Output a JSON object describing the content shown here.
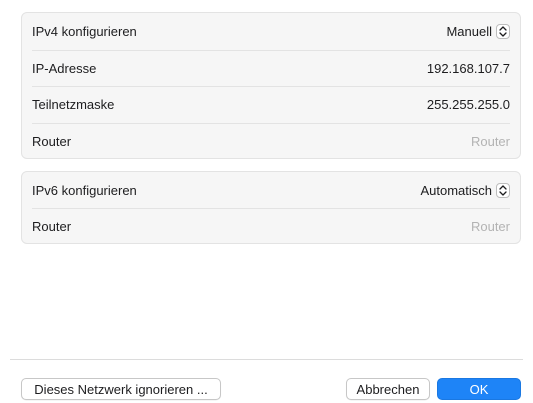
{
  "ipv4": {
    "configure_label": "IPv4 konfigurieren",
    "configure_value": "Manuell",
    "ip_label": "IP-Adresse",
    "ip_value": "192.168.107.7",
    "subnet_label": "Teilnetzmaske",
    "subnet_value": "255.255.255.0",
    "router_label": "Router",
    "router_placeholder": "Router"
  },
  "ipv6": {
    "configure_label": "IPv6 konfigurieren",
    "configure_value": "Automatisch",
    "router_label": "Router",
    "router_value": "Router"
  },
  "buttons": {
    "ignore": "Dieses Netzwerk ignorieren ...",
    "cancel": "Abbrechen",
    "ok": "OK"
  },
  "colors": {
    "accent": "#1e84f7",
    "placeholder": "#b3b3b3"
  }
}
